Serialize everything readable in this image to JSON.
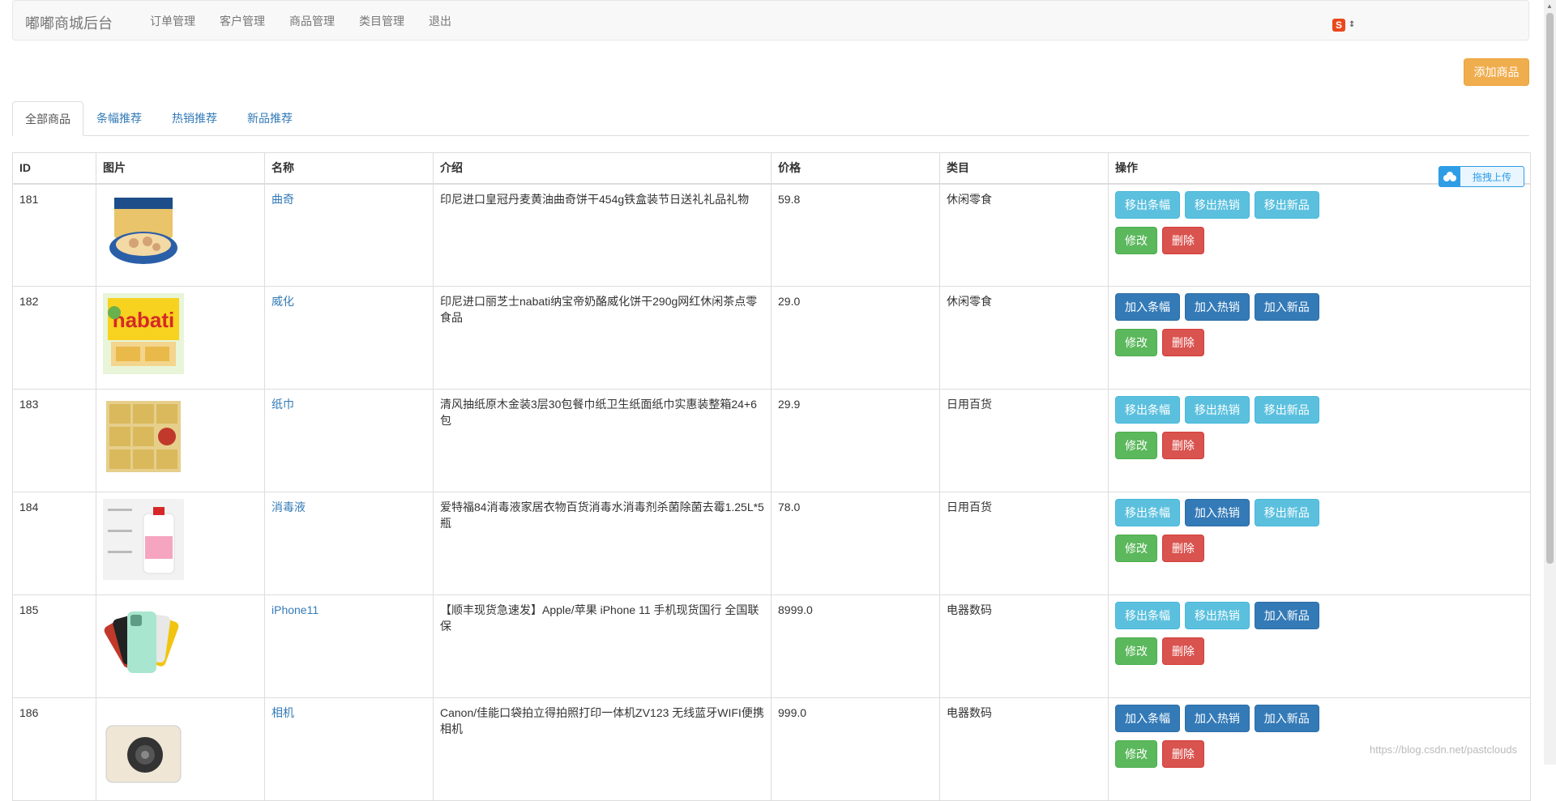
{
  "navbar": {
    "brand": "嘟嘟商城后台",
    "links": [
      "订单管理",
      "客户管理",
      "商品管理",
      "类目管理",
      "退出"
    ]
  },
  "ime": {
    "logo": "S",
    "arrow": "⇕"
  },
  "actions": {
    "add_product": "添加商品"
  },
  "tabs": [
    "全部商品",
    "条幅推荐",
    "热销推荐",
    "新品推荐"
  ],
  "table": {
    "headers": [
      "ID",
      "图片",
      "名称",
      "介绍",
      "价格",
      "类目",
      "操作"
    ],
    "rows": [
      {
        "id": "181",
        "name": "曲奇",
        "intro": "印尼进口皇冠丹麦黄油曲奇饼干454g铁盒装节日送礼礼品礼物",
        "price": "59.8",
        "category": "休闲零食",
        "banner": "移出条幅",
        "hot": "移出热销",
        "new": "移出新品",
        "image": "cookie-tin"
      },
      {
        "id": "182",
        "name": "威化",
        "intro": "印尼进口丽芝士nabati纳宝帝奶酪威化饼干290g网红休闲茶点零食品",
        "price": "29.0",
        "category": "休闲零食",
        "banner": "加入条幅",
        "hot": "加入热销",
        "new": "加入新品",
        "image": "wafer-box"
      },
      {
        "id": "183",
        "name": "纸巾",
        "intro": "清风抽纸原木金装3层30包餐巾纸卫生纸面纸巾实惠装整箱24+6包",
        "price": "29.9",
        "category": "日用百货",
        "banner": "移出条幅",
        "hot": "移出热销",
        "new": "移出新品",
        "image": "tissue-pack"
      },
      {
        "id": "184",
        "name": "消毒液",
        "intro": "爱特福84消毒液家居衣物百货消毒水消毒剂杀菌除菌去霉1.25L*5瓶",
        "price": "78.0",
        "category": "日用百货",
        "banner": "移出条幅",
        "hot": "加入热销",
        "new": "移出新品",
        "image": "disinfectant-bottle"
      },
      {
        "id": "185",
        "name": "iPhone11",
        "intro": "【顺丰现货急速发】Apple/苹果 iPhone 11 手机现货国行 全国联保",
        "price": "8999.0",
        "category": "电器数码",
        "banner": "移出条幅",
        "hot": "移出热销",
        "new": "加入新品",
        "image": "iphone-fan"
      },
      {
        "id": "186",
        "name": "相机",
        "intro": "Canon/佳能口袋拍立得拍照打印一体机ZV123 无线蓝牙WIFI便携相机",
        "price": "999.0",
        "category": "电器数码",
        "banner": "加入条幅",
        "hot": "加入热销",
        "new": "加入新品",
        "image": "camera"
      }
    ],
    "edit_label": "修改",
    "delete_label": "删除"
  },
  "upload_widget": {
    "label": "拖拽上传"
  },
  "watermark": "https://blog.csdn.net/pastclouds",
  "colors": {
    "info": "#5bc0de",
    "primary": "#337ab7",
    "success": "#5cb85c",
    "danger": "#d9534f",
    "warning": "#f0ad4e",
    "link": "#337ab7"
  }
}
